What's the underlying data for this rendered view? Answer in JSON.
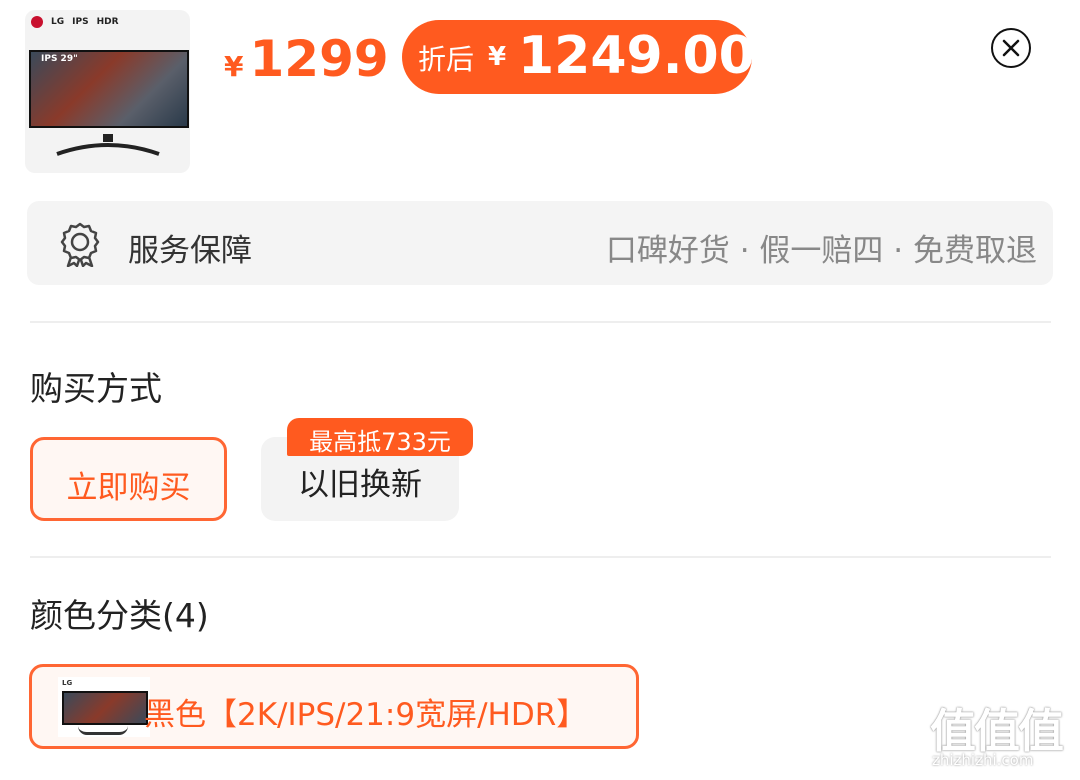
{
  "product": {
    "thumbnail_brand": "LG",
    "thumbnail_badges": [
      "IPS",
      "HDR"
    ],
    "thumbnail_screen_label": "IPS 29\""
  },
  "price": {
    "currency": "¥",
    "original": "1299",
    "discount_label": "折后",
    "discounted": "1249.00"
  },
  "service": {
    "label": "服务保障",
    "detail": "口碑好货 · 假一赔四 · 免费取退"
  },
  "purchase": {
    "title": "购买方式",
    "options": [
      {
        "label": "立即购买",
        "selected": true
      },
      {
        "label": "以旧换新",
        "badge": "最高抵733元",
        "selected": false
      }
    ]
  },
  "color": {
    "title": "颜色分类(4)",
    "options": [
      {
        "label": "黑色【2K/IPS/21:9宽屏/HDR】",
        "selected": true
      }
    ]
  },
  "watermark": {
    "mark": "值值值",
    "site": "zhizhizhi.com"
  },
  "colors": {
    "accent": "#ff5a1f",
    "accent_border": "#ff6633",
    "panel_bg": "#f4f4f4",
    "muted_text": "#888888"
  },
  "icons": {
    "service": "certificate-badge-icon",
    "close": "close-circle-icon"
  }
}
